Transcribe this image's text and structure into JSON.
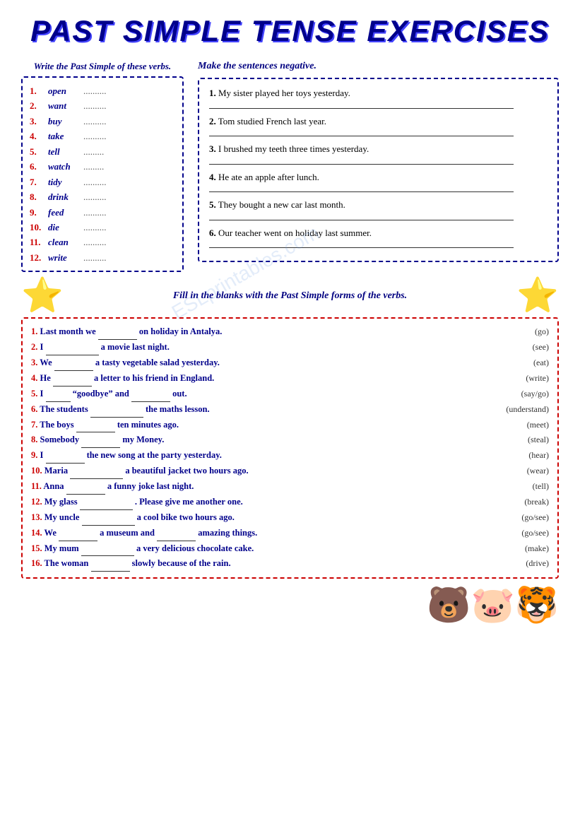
{
  "title": "PAST SIMPLE TENSE EXERCISES",
  "section1": {
    "left_title": "Write the Past Simple of these verbs.",
    "verbs": [
      {
        "num": "1.",
        "word": "open",
        "dots": ".........."
      },
      {
        "num": "2.",
        "word": "want",
        "dots": ".........."
      },
      {
        "num": "3.",
        "word": "buy",
        "dots": ".........."
      },
      {
        "num": "4.",
        "word": "take",
        "dots": ".........."
      },
      {
        "num": "5.",
        "word": "tell",
        "dots": "........."
      },
      {
        "num": "6.",
        "word": "watch",
        "dots": "........."
      },
      {
        "num": "7.",
        "word": "tidy",
        "dots": ".........."
      },
      {
        "num": "8.",
        "word": "drink",
        "dots": ".........."
      },
      {
        "num": "9.",
        "word": "feed",
        "dots": ".........."
      },
      {
        "num": "10.",
        "word": "die",
        "dots": ".........."
      },
      {
        "num": "11.",
        "word": "clean",
        "dots": ".........."
      },
      {
        "num": "12.",
        "word": "write",
        "dots": ".........."
      }
    ],
    "right_title": "Make the sentences negative.",
    "sentences": [
      {
        "num": "1.",
        "text": "My sister played her toys yesterday."
      },
      {
        "num": "2.",
        "text": "Tom studied French last year."
      },
      {
        "num": "3.",
        "text": "I brushed my teeth three times yesterday."
      },
      {
        "num": "4.",
        "text": "He ate an apple after lunch."
      },
      {
        "num": "5.",
        "text": "They bought a new car last month."
      },
      {
        "num": "6.",
        "text": "Our teacher went on holiday last summer."
      }
    ]
  },
  "section2": {
    "title": "Fill in the blanks with the Past Simple forms of the verbs.",
    "sentences": [
      {
        "num": "1.",
        "text_before": "Last month we",
        "blank1": true,
        "blank1_size": "normal",
        "text_after": "on holiday in Antalya.",
        "verb": "(go)"
      },
      {
        "num": "2.",
        "text_before": "I",
        "blank1": true,
        "blank1_size": "wide",
        "text_after": "a movie last night.",
        "verb": "(see)"
      },
      {
        "num": "3.",
        "text_before": "We",
        "blank1": true,
        "blank1_size": "normal",
        "text_after": "a tasty vegetable salad yesterday.",
        "verb": "(eat)"
      },
      {
        "num": "4.",
        "text_before": "He",
        "blank1": true,
        "blank1_size": "normal",
        "text_after": "a letter to his friend in England.",
        "verb": "(write)"
      },
      {
        "num": "5.",
        "text_before": "I",
        "blank1": true,
        "blank1_size": "small",
        "text_mid": "“goodbye” and",
        "blank2": true,
        "text_after": "out.",
        "verb": "(say/go)"
      },
      {
        "num": "6.",
        "text_before": "The students",
        "blank1": true,
        "blank1_size": "wide",
        "text_after": "the maths lesson.",
        "verb": "(understand)"
      },
      {
        "num": "7.",
        "text_before": "The boys",
        "blank1": true,
        "blank1_size": "normal",
        "text_after": "ten minutes ago.",
        "verb": "(meet)"
      },
      {
        "num": "8.",
        "text_before": "Somebody",
        "blank1": true,
        "blank1_size": "normal",
        "text_after": "my Money.",
        "verb": "(steal)"
      },
      {
        "num": "9.",
        "text_before": "I",
        "blank1": true,
        "blank1_size": "normal",
        "text_after": "the new song at the party yesterday.",
        "verb": "(hear)"
      },
      {
        "num": "10.",
        "text_before": "Maria",
        "blank1": true,
        "blank1_size": "wide",
        "text_after": "a beautiful jacket two hours ago.",
        "verb": "(wear)"
      },
      {
        "num": "11.",
        "text_before": "Anna",
        "blank1": true,
        "blank1_size": "normal",
        "text_after": "a funny joke last night.",
        "verb": "(tell)"
      },
      {
        "num": "12.",
        "text_before": "My glass",
        "blank1": true,
        "blank1_size": "wide",
        "text_after": ". Please give me another one.",
        "verb": "(break)"
      },
      {
        "num": "13.",
        "text_before": "My uncle",
        "blank1": true,
        "blank1_size": "wide",
        "text_after": "a cool bike two hours ago.",
        "verb": "(go/see)"
      },
      {
        "num": "14.",
        "text_before": "We",
        "blank1": true,
        "blank1_size": "normal",
        "text_mid": "a museum and",
        "blank2": true,
        "text_after": "amazing things.",
        "verb": "(go/see)"
      },
      {
        "num": "15.",
        "text_before": "My mum",
        "blank1": true,
        "blank1_size": "wide",
        "text_after": "a very delicious chocolate cake.",
        "verb": "(make)"
      },
      {
        "num": "16.",
        "text_before": "The woman",
        "blank1": true,
        "blank1_size": "normal",
        "text_after": "slowly because of the rain.",
        "verb": "(drive)"
      }
    ]
  }
}
